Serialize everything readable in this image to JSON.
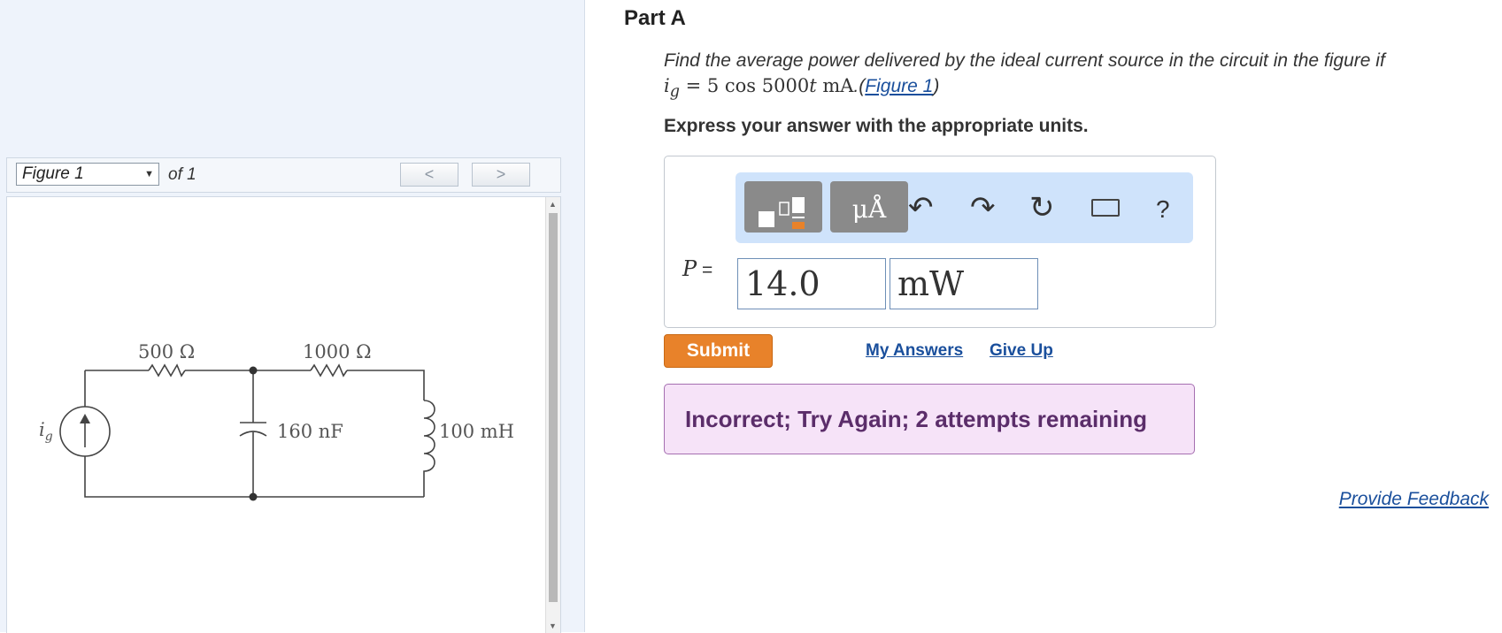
{
  "figure_panel": {
    "select_value": "Figure 1",
    "of_label": "of 1",
    "prev_label": "<",
    "next_label": ">",
    "circuit": {
      "r1": "500 Ω",
      "r2": "1000 Ω",
      "c1": "160 nF",
      "l1": "100 mH",
      "source_label_main": "i",
      "source_label_sub": "g"
    }
  },
  "part": {
    "title": "Part A",
    "question_text": "Find the average power delivered by the ideal current source in the circuit in the figure if",
    "question_math_var": "i",
    "question_math_sub": "g",
    "question_math_rest": " = 5 cos 5000",
    "question_math_t": "t",
    "question_math_unit": " mA",
    "question_period": ".",
    "figure_link": "Figure 1",
    "units_note": "Express your answer with the appropriate units."
  },
  "toolbar": {
    "units_label": "μÅ",
    "undo_icon": "undo-icon",
    "redo_icon": "redo-icon",
    "reset_icon": "reset-icon",
    "keyboard_icon": "keyboard-icon",
    "help_label": "?"
  },
  "answer": {
    "var_label": "P",
    "equals": " =",
    "value": "14.0",
    "unit": "mW"
  },
  "actions": {
    "submit": "Submit",
    "my_answers": "My Answers",
    "give_up": "Give Up"
  },
  "feedback": {
    "message": "Incorrect; Try Again; 2 attempts remaining"
  },
  "footer": {
    "provide_feedback": "Provide Feedback"
  }
}
